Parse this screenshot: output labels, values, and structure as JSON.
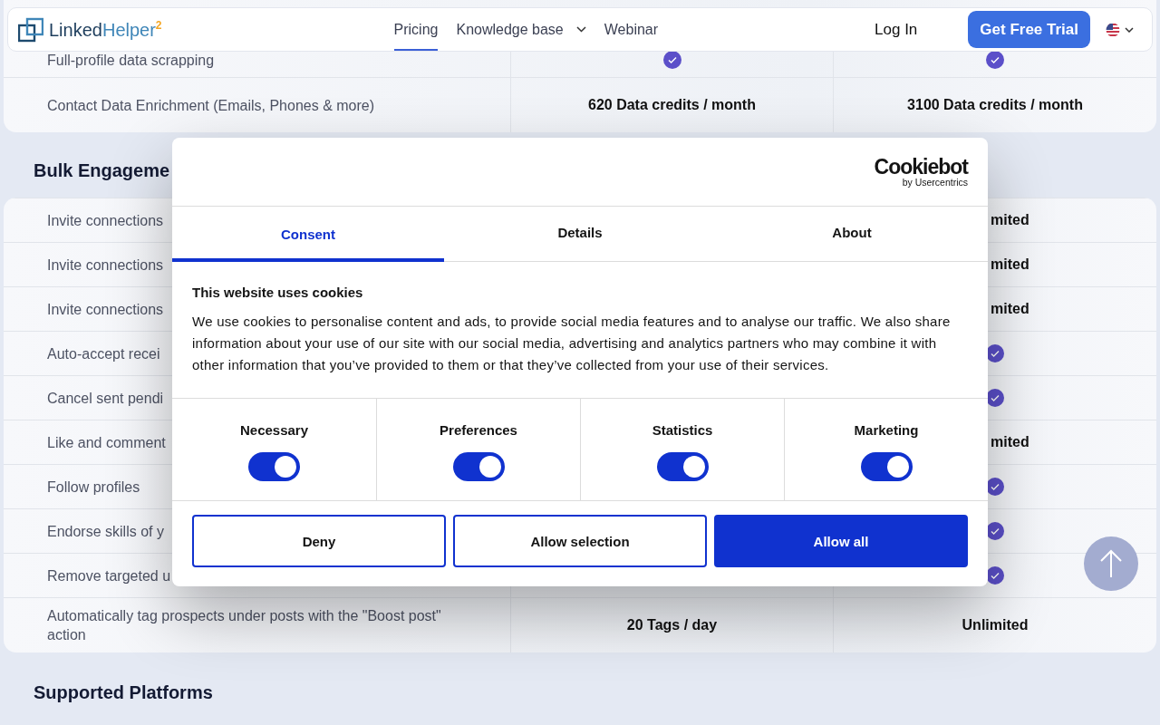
{
  "header": {
    "logo": {
      "name_dark": "Linked",
      "name_light": "Helper",
      "superscript": "2"
    },
    "nav": [
      {
        "label": "Pricing",
        "selected": true,
        "dropdown": false
      },
      {
        "label": "Knowledge base",
        "selected": false,
        "dropdown": true
      },
      {
        "label": "Webinar",
        "selected": false,
        "dropdown": false
      }
    ],
    "login": "Log In",
    "cta": "Get Free Trial"
  },
  "sections": [
    {
      "rows": [
        {
          "label": "Full-profile data scrapping",
          "plan_1": {
            "kind": "check"
          },
          "plan_2": {
            "kind": "check"
          }
        },
        {
          "label": "Contact Data Enrichment (Emails, Phones & more)",
          "plan_1": {
            "kind": "text",
            "text": "620 Data credits / month"
          },
          "plan_2": {
            "kind": "text",
            "text": "3100 Data credits / month"
          }
        }
      ]
    },
    {
      "title": "Bulk Engageme",
      "rows": [
        {
          "label": "Invite connections",
          "plan_2": {
            "kind": "clipped",
            "text": "mited"
          }
        },
        {
          "label": "Invite connections",
          "plan_2": {
            "kind": "clipped",
            "text": "mited"
          }
        },
        {
          "label": "Invite connections",
          "plan_2": {
            "kind": "clipped",
            "text": "mited"
          }
        },
        {
          "label": "Auto-accept recei",
          "plan_2": {
            "kind": "check"
          }
        },
        {
          "label": "Cancel sent pendi",
          "plan_2": {
            "kind": "check"
          }
        },
        {
          "label": "Like and comment",
          "plan_2": {
            "kind": "clipped",
            "text": "mited"
          }
        },
        {
          "label": "Follow profiles",
          "plan_2": {
            "kind": "check"
          }
        },
        {
          "label": "Endorse skills of y",
          "plan_2": {
            "kind": "check"
          }
        },
        {
          "label": "Remove targeted u",
          "plan_2": {
            "kind": "check"
          }
        },
        {
          "label": "Automatically tag prospects under posts with the \"Boost post\" action",
          "plan_1": {
            "kind": "text",
            "text": "20 Tags / day"
          },
          "plan_2": {
            "kind": "text",
            "text": "Unlimited"
          }
        }
      ]
    },
    {
      "title": "Supported Platforms"
    }
  ],
  "cookie_dialog": {
    "logo": "Cookiebot",
    "logo_sub": "by Usercentrics",
    "tabs": [
      {
        "label": "Consent",
        "selected": true
      },
      {
        "label": "Details",
        "selected": false
      },
      {
        "label": "About",
        "selected": false
      }
    ],
    "title": "This website uses cookies",
    "text": "We use cookies to personalise content and ads, to provide social media features and to analyse our traffic. We also share information about your use of our site with our social media, advertising and analytics partners who may combine it with other information that you’ve provided to them or that they’ve collected from your use of their services.",
    "categories": [
      {
        "label": "Necessary",
        "on": true
      },
      {
        "label": "Preferences",
        "on": true
      },
      {
        "label": "Statistics",
        "on": true
      },
      {
        "label": "Marketing",
        "on": true
      }
    ],
    "buttons": [
      {
        "label": "Deny",
        "kind": "outline"
      },
      {
        "label": "Allow selection",
        "kind": "outline"
      },
      {
        "label": "Allow all",
        "kind": "primary"
      }
    ]
  }
}
